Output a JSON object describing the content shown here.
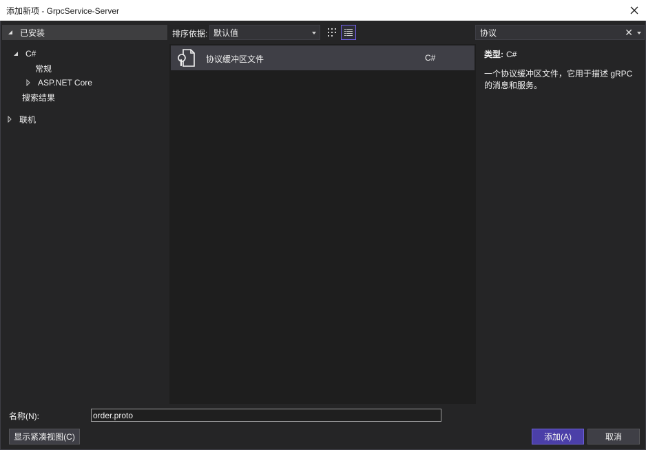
{
  "window": {
    "title": "添加新项 - GrpcService-Server",
    "close_icon": "close-icon"
  },
  "tree": {
    "installed_label": "已安装",
    "csharp_label": "C#",
    "general_label": "常规",
    "aspnet_label": "ASP.NET Core",
    "search_results_label": "搜索结果",
    "online_label": "联机"
  },
  "toolbar": {
    "sort_label": "排序依据:",
    "sort_value": "默认值",
    "view_grid_icon": "grid-view-icon",
    "view_list_icon": "list-view-icon"
  },
  "search": {
    "value": "协议",
    "clear_icon": "close-icon",
    "dropdown_icon": "chevron-down-icon"
  },
  "templates": [
    {
      "name": "协议缓冲区文件",
      "language": "C#",
      "icon": "protobuf-file-icon",
      "selected": true
    }
  ],
  "details": {
    "type_label": "类型:",
    "type_value": "C#",
    "description": "一个协议缓冲区文件，它用于描述 gRPC 的消息和服务。"
  },
  "footer": {
    "name_label": "名称(N):",
    "name_value": "order.proto",
    "compact_view_label": "显示紧凑视图(C)",
    "add_label": "添加(A)",
    "cancel_label": "取消"
  },
  "colors": {
    "background": "#252526",
    "list_background": "#1e1e1e",
    "selected_item": "#3f3f46",
    "accent": "#4b3fa8"
  }
}
